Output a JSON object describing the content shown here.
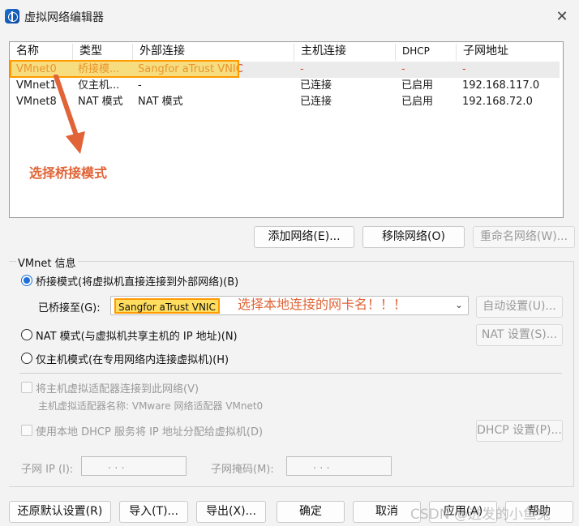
{
  "window": {
    "title": "虚拟网络编辑器"
  },
  "list": {
    "columns": [
      "名称",
      "类型",
      "外部连接",
      "主机连接",
      "DHCP",
      "子网地址"
    ],
    "rows": [
      [
        "VMnet0",
        "桥接模...",
        "Sangfor aTrust VNIC",
        "-",
        "-",
        "-"
      ],
      [
        "VMnet1",
        "仅主机...",
        "-",
        "已连接",
        "已启用",
        "192.168.117.0"
      ],
      [
        "VMnet8",
        "NAT 模式",
        "NAT 模式",
        "已连接",
        "已启用",
        "192.168.72.0"
      ]
    ],
    "selected_row": 0
  },
  "annotations": {
    "select_bridge": "选择桥接模式",
    "select_nic": "选择本地连接的网卡名！！！",
    "color": "#e06437"
  },
  "list_buttons": {
    "add": "添加网络(E)...",
    "remove": "移除网络(O)",
    "rename": "重命名网络(W)..."
  },
  "vmnet_info": {
    "group_label": "VMnet 信息",
    "bridged": "桥接模式(将虚拟机直接连接到外部网络)(B)",
    "bridged_to_label": "已桥接至(G):",
    "bridged_to_value": "Sangfor aTrust VNIC",
    "auto_settings": "自动设置(U)...",
    "nat": "NAT 模式(与虚拟机共享主机的 IP 地址)(N)",
    "nat_settings": "NAT 设置(S)...",
    "host_only": "仅主机模式(在专用网络内连接虚拟机)(H)",
    "connect_adapter": "将主机虚拟适配器连接到此网络(V)",
    "adapter_name": "主机虚拟适配器名称: VMware 网络适配器 VMnet0",
    "use_dhcp": "使用本地 DHCP 服务将 IP 地址分配给虚拟机(D)",
    "dhcp_settings": "DHCP 设置(P)...",
    "subnet_ip_label": "子网 IP (I):",
    "subnet_mask_label": "子网掩码(M):",
    "ip_dots": ".       .       ."
  },
  "bottom_buttons": {
    "restore": "还原默认设置(R)",
    "import": "导入(T)...",
    "export": "导出(X)...",
    "ok": "确定",
    "cancel": "取消",
    "apply": "应用(A)",
    "help": "帮助"
  },
  "watermark": "CSDN @迸发的小鱼兔",
  "selected_radio": "bridged",
  "accent_color": "#1e6fd9",
  "highlight_color": "#ff9a00"
}
